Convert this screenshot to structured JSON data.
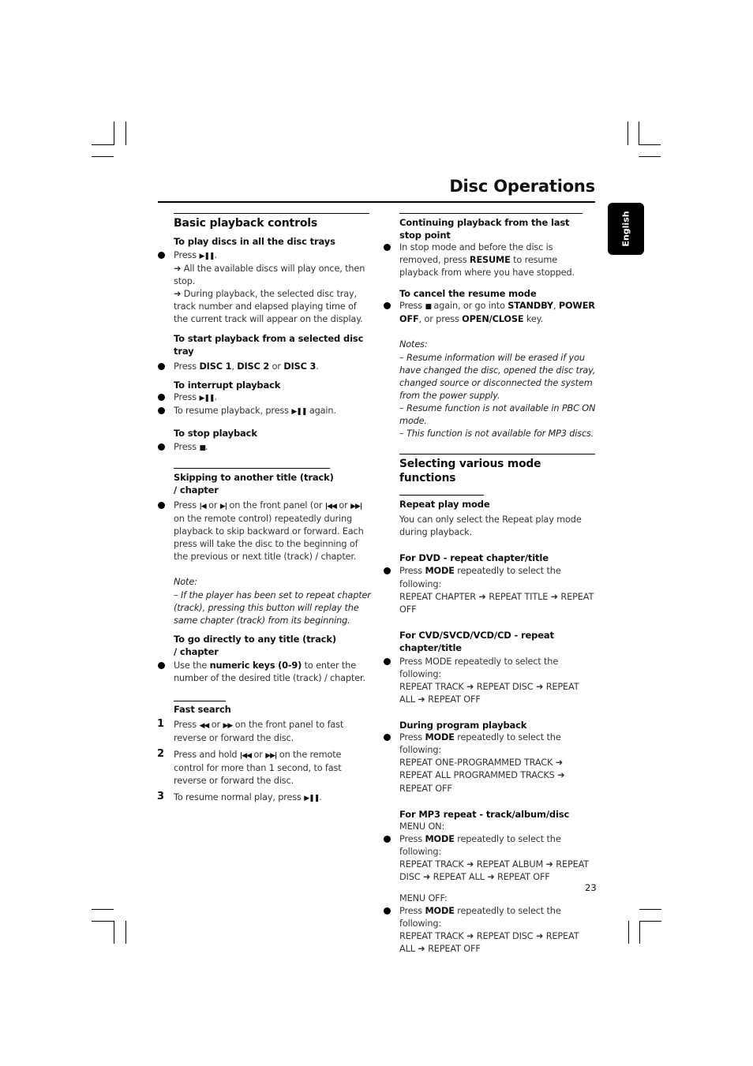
{
  "header": {
    "title": "Disc Operations",
    "language_tab": "English"
  },
  "page_number": "23",
  "icons": {
    "play_pause": "▶❚❚",
    "stop": "■",
    "prev": "|◀",
    "next": "▶|",
    "skip_back": "|◀◀",
    "skip_fwd": "▶▶|",
    "rewind": "◀◀",
    "ffwd": "▶▶",
    "arrow": "➜"
  },
  "left": {
    "basic": {
      "heading": "Basic playback controls",
      "play_all": {
        "title": "To play discs in all the disc trays",
        "press": "Press",
        "result1": "All the available discs will play once, then stop.",
        "result2": "During playback, the selected disc tray, track number and elapsed playing time of the current track will appear on the display."
      },
      "start_selected": {
        "title": "To start playback from a selected disc tray",
        "press": "Press",
        "disc1": "DISC 1",
        "disc2": "DISC 2",
        "or": "or",
        "disc3": "DISC 3"
      },
      "interrupt": {
        "title": "To interrupt playback",
        "press": "Press",
        "resume_pre": "To resume playback, press",
        "resume_post": "again."
      },
      "stop": {
        "title": "To stop playback",
        "press": "Press"
      }
    },
    "skip": {
      "heading": "Skipping to another title (track) / chapter",
      "t1": "Press",
      "t2": "or",
      "t3": "on the front panel (or",
      "t4": "or",
      "t5": "on the remote control) repeatedly during playback to skip backward or forward. Each press will take the disc to the beginning of the previous or next title (track) / chapter.",
      "note_label": "Note:",
      "note": "–  If the player has been set to repeat chapter (track), pressing this button will replay the same chapter (track) from its beginning."
    },
    "direct": {
      "title": "To go directly to any title (track) / chapter",
      "pre": "Use the",
      "bold": "numeric keys (0-9)",
      "post": "to enter the number of the desired title (track)  / chapter."
    },
    "fast": {
      "heading": "Fast search",
      "steps": [
        {
          "n": "1",
          "pre": "Press",
          "mid": "or",
          "post": "on the front panel to fast reverse or forward the disc."
        },
        {
          "n": "2",
          "pre": "Press and hold",
          "mid": "or",
          "post": "on the remote control for more than 1 second, to fast reverse or forward the disc."
        },
        {
          "n": "3",
          "pre": "To resume normal play, press"
        }
      ]
    }
  },
  "right": {
    "continue": {
      "title": "Continuing playback from the last stop point",
      "pre": "In stop mode and before the disc is removed, press",
      "bold": "RESUME",
      "post": "to resume playback from where you have stopped."
    },
    "cancel": {
      "title": "To cancel the resume mode",
      "pre": "Press",
      "mid": "again, or go into",
      "b1": "STANDBY",
      "b2": "POWER OFF",
      "mid2": ", or press",
      "b3": "OPEN/CLOSE",
      "post": "key."
    },
    "notes": {
      "label": "Notes:",
      "items": [
        "–  Resume information will be erased if you have changed the disc, opened the disc tray, changed source or disconnected the system from the power supply.",
        "–  Resume function is not available in PBC ON mode.",
        "–  This function is not available for MP3 discs."
      ]
    },
    "modes": {
      "heading": "Selecting various mode functions",
      "repeat_title": "Repeat play mode",
      "repeat_desc": "You can only select the Repeat play mode during playback.",
      "press": "Press",
      "mode": "MODE",
      "repeatedly": "repeatedly to select the following:",
      "dvd": {
        "title": "For DVD - repeat chapter/title",
        "seq": "REPEAT CHAPTER ➜ REPEAT TITLE ➜ REPEAT OFF"
      },
      "cvd": {
        "title": "For CVD/SVCD/VCD/CD - repeat chapter/title",
        "line": "Press MODE repeatedly to select the following:",
        "seq": "REPEAT TRACK ➜ REPEAT DISC ➜ REPEAT ALL ➜ REPEAT OFF"
      },
      "program": {
        "title": "During program playback",
        "seq": "REPEAT ONE-PROGRAMMED TRACK ➜ REPEAT ALL PROGRAMMED TRACKS ➜ REPEAT OFF"
      },
      "mp3": {
        "title": "For MP3 repeat - track/album/disc",
        "menu_on": "MENU ON:",
        "seq_on": "REPEAT TRACK ➜ REPEAT ALBUM ➜ REPEAT DISC ➜ REPEAT ALL ➜ REPEAT OFF",
        "menu_off": "MENU OFF:",
        "seq_off": "REPEAT TRACK ➜ REPEAT DISC ➜ REPEAT ALL ➜ REPEAT OFF"
      }
    }
  }
}
